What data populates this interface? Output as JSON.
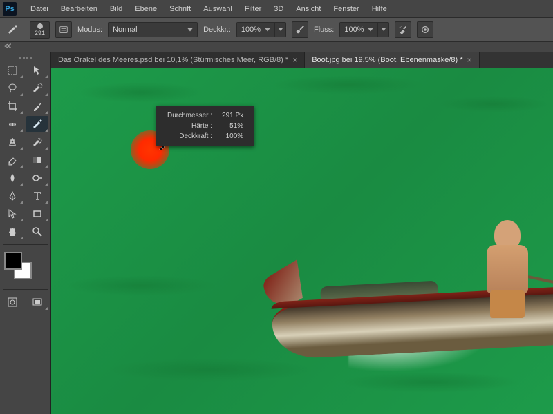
{
  "menu": {
    "items": [
      "Datei",
      "Bearbeiten",
      "Bild",
      "Ebene",
      "Schrift",
      "Auswahl",
      "Filter",
      "3D",
      "Ansicht",
      "Fenster",
      "Hilfe"
    ]
  },
  "optbar": {
    "brush_size": "291",
    "mode_label": "Modus:",
    "mode_value": "Normal",
    "opacity_label": "Deckkr.:",
    "opacity_value": "100%",
    "flow_label": "Fluss:",
    "flow_value": "100%"
  },
  "tabs": [
    {
      "label": "Das Orakel des Meeres.psd bei 10,1%  (Stürmisches Meer, RGB/8) *",
      "active": false
    },
    {
      "label": "Boot.jpg bei 19,5% (Boot, Ebenenmaske/8) *",
      "active": true
    }
  ],
  "hud": {
    "diameter_label": "Durchmesser :",
    "diameter_value": "291 Px",
    "hardness_label": "Härte :",
    "hardness_value": "51%",
    "opacity_label": "Deckkraft :",
    "opacity_value": "100%"
  },
  "colors": {
    "accent": "#ff3500",
    "fg": "#000000",
    "bg": "#ffffff",
    "canvas_green": "#1d9b4a"
  }
}
